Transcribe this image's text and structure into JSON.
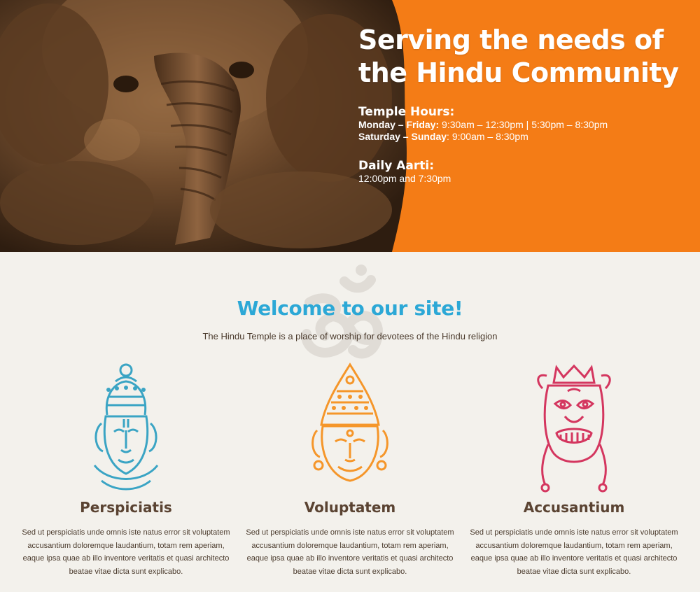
{
  "hero": {
    "heading_line1": "Serving the needs of",
    "heading_line2": "the Hindu Community",
    "hours_title": "Temple Hours:",
    "weekday_label": "Monday – Friday:",
    "weekday_times": " 9:30am – 12:30pm | 5:30pm – 8:30pm",
    "weekend_label": "Saturday – Sunday",
    "weekend_times": ": 9:00am – 8:30pm",
    "aarti_title": "Daily Aarti:",
    "aarti_times": "12:00pm and 7:30pm",
    "image_icon": "ganesha-statue-photo",
    "accent_color": "#f47c16"
  },
  "welcome": {
    "title": "Welcome to our site!",
    "subtitle": "The Hindu Temple is a place of worship for devotees of the Hindu religion",
    "watermark_icon": "om-symbol-icon",
    "title_color": "#2ca8d6"
  },
  "features": [
    {
      "title": "Perspiciatis",
      "text": "Sed ut perspiciatis unde omnis iste natus error sit voluptatem accusantium doloremque laudantium, totam rem aperiam, eaque ipsa quae ab illo inventore veritatis et quasi architecto beatae vitae dicta sunt explicabo.",
      "icon": "deity-face-icon",
      "color": "#3aa4c4"
    },
    {
      "title": "Voluptatem",
      "text": "Sed ut perspiciatis unde omnis iste natus error sit voluptatem accusantium doloremque laudantium, totam rem aperiam, eaque ipsa quae ab illo inventore veritatis et quasi architecto beatae vitae dicta sunt explicabo.",
      "icon": "crowned-face-icon",
      "color": "#f5962a"
    },
    {
      "title": "Accusantium",
      "text": "Sed ut perspiciatis unde omnis iste natus error sit voluptatem accusantium doloremque laudantium, totam rem aperiam, eaque ipsa quae ab illo inventore veritatis et quasi architecto beatae vitae dicta sunt explicabo.",
      "icon": "demon-mask-icon",
      "color": "#d4365f"
    }
  ]
}
